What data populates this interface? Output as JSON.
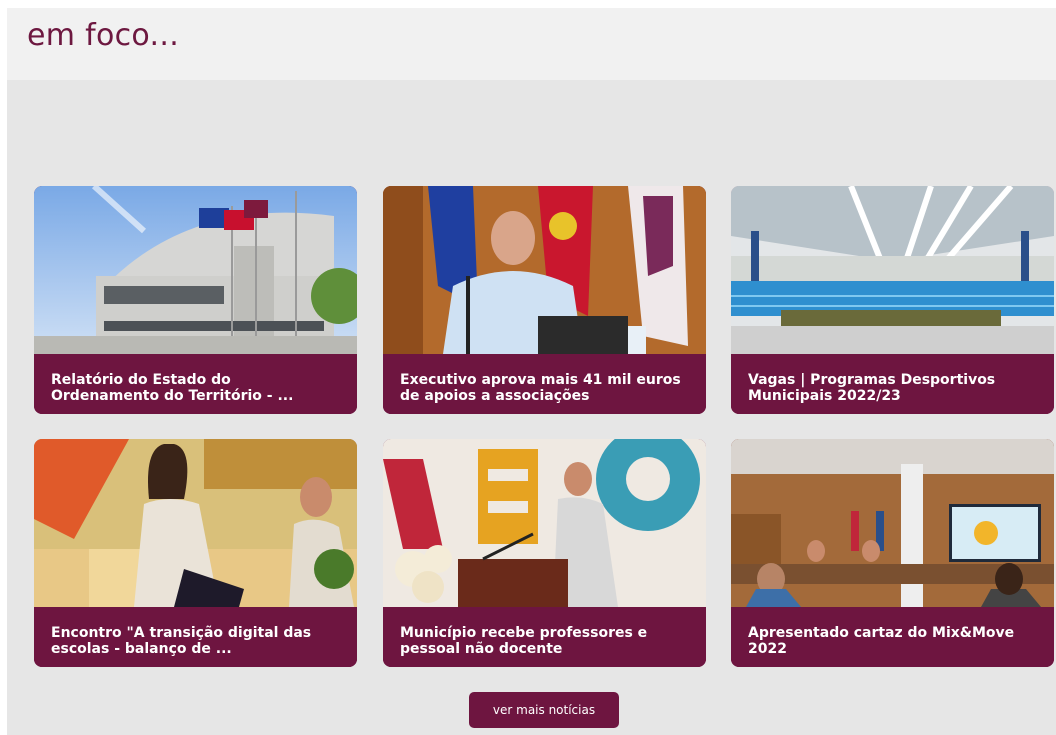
{
  "section": {
    "title": "em foco..."
  },
  "cards": [
    {
      "title": "Relatório do Estado do Ordenamento do Território - ...",
      "image": "town-hall-building-photo"
    },
    {
      "title": "Executivo aprova mais 41 mil euros de apoios a associações",
      "image": "official-at-desk-photo"
    },
    {
      "title": "Vagas | Programas Desportivos Municipais 2022/23",
      "image": "indoor-swimming-pool-photo"
    },
    {
      "title": "Encontro \"A transição digital das escolas - balanço de ...",
      "image": "speaker-on-stage-photo"
    },
    {
      "title": "Município recebe professores e pessoal não docente",
      "image": "speaker-at-podium-photo"
    },
    {
      "title": "Apresentado cartaz do Mix&Move 2022",
      "image": "meeting-room-presentation-photo"
    }
  ],
  "more_button": {
    "label": "ver mais notícias"
  }
}
